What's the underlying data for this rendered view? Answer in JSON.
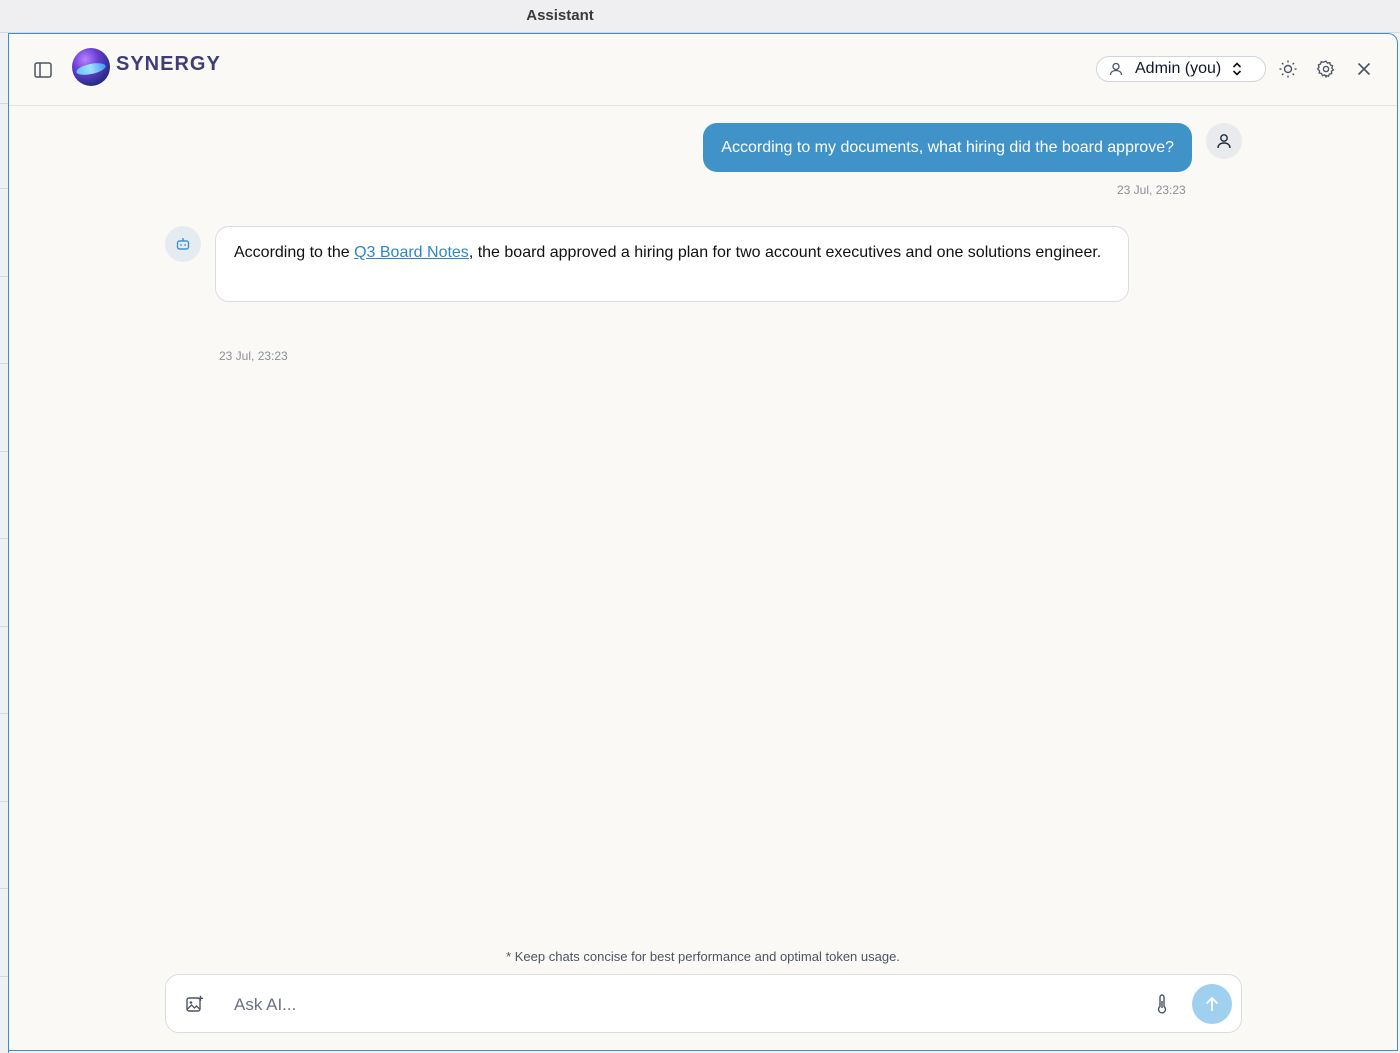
{
  "window": {
    "title": "Assistant"
  },
  "header": {
    "brand": "SYNERGY",
    "user_select": "Admin (you)",
    "icons": [
      "sidebar-toggle-icon",
      "user-icon",
      "chevron-updown-icon",
      "sun-icon",
      "gear-icon",
      "close-icon"
    ]
  },
  "messages": [
    {
      "role": "user",
      "text": "According to my documents, what hiring did the board approve?",
      "time": "23 Jul, 23:23"
    },
    {
      "role": "assistant",
      "text_before": "According to the ",
      "link": "Q3 Board Notes",
      "text_after": ", the board approved a hiring plan for two account executives and one solutions engineer.",
      "time": "23 Jul, 23:23"
    }
  ],
  "footer": {
    "hint": "* Keep chats concise for best performance and optimal token usage.",
    "input_placeholder": "Ask AI...",
    "icons": [
      "image-add-icon",
      "thermometer-icon",
      "send-arrow-icon"
    ]
  },
  "colors": {
    "accent": "#3f93c9",
    "send_disabled": "#9fd0ef",
    "background": "#faf9f6"
  }
}
